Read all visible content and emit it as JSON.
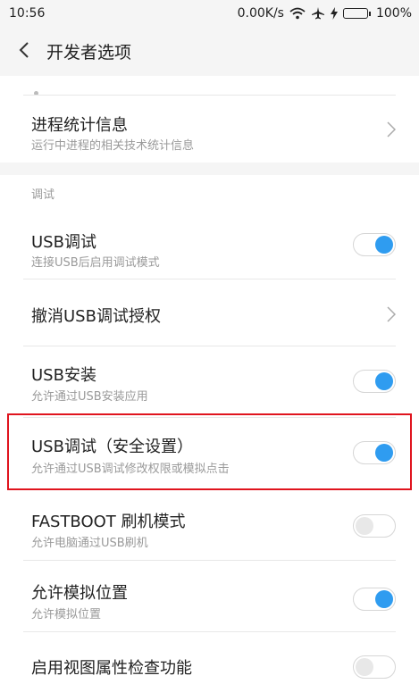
{
  "status_bar": {
    "time": "10:56",
    "speed": "0.00K/s",
    "battery": "100%",
    "icons": [
      "wifi-icon",
      "airplane-icon",
      "charging-icon",
      "battery-icon"
    ]
  },
  "header": {
    "title": "开发者选项",
    "back_icon": "chevron-left-icon"
  },
  "sections": [
    {
      "items": [
        {
          "title": "进程统计信息",
          "subtitle": "运行中进程的相关技术统计信息",
          "control": "chevron"
        }
      ]
    },
    {
      "header": "调试",
      "items": [
        {
          "title": "USB调试",
          "subtitle": "连接USB后启用调试模式",
          "control": "toggle",
          "enabled": true
        },
        {
          "title": "撤消USB调试授权",
          "subtitle": "",
          "control": "chevron"
        },
        {
          "title": "USB安装",
          "subtitle": "允许通过USB安装应用",
          "control": "toggle",
          "enabled": true
        },
        {
          "title": "USB调试（安全设置）",
          "subtitle": "允许通过USB调试修改权限或模拟点击",
          "control": "toggle",
          "enabled": true,
          "highlighted": true
        },
        {
          "title": "FASTBOOT 刷机模式",
          "subtitle": "允许电脑通过USB刷机",
          "control": "toggle",
          "enabled": false
        },
        {
          "title": "允许模拟位置",
          "subtitle": "允许模拟位置",
          "control": "toggle",
          "enabled": true
        },
        {
          "title": "启用视图属性检查功能",
          "subtitle": "",
          "control": "toggle",
          "enabled": false
        }
      ]
    }
  ],
  "colors": {
    "accent": "#2f9cf0",
    "highlight_border": "#e0141e",
    "background": "#f5f5f5"
  }
}
